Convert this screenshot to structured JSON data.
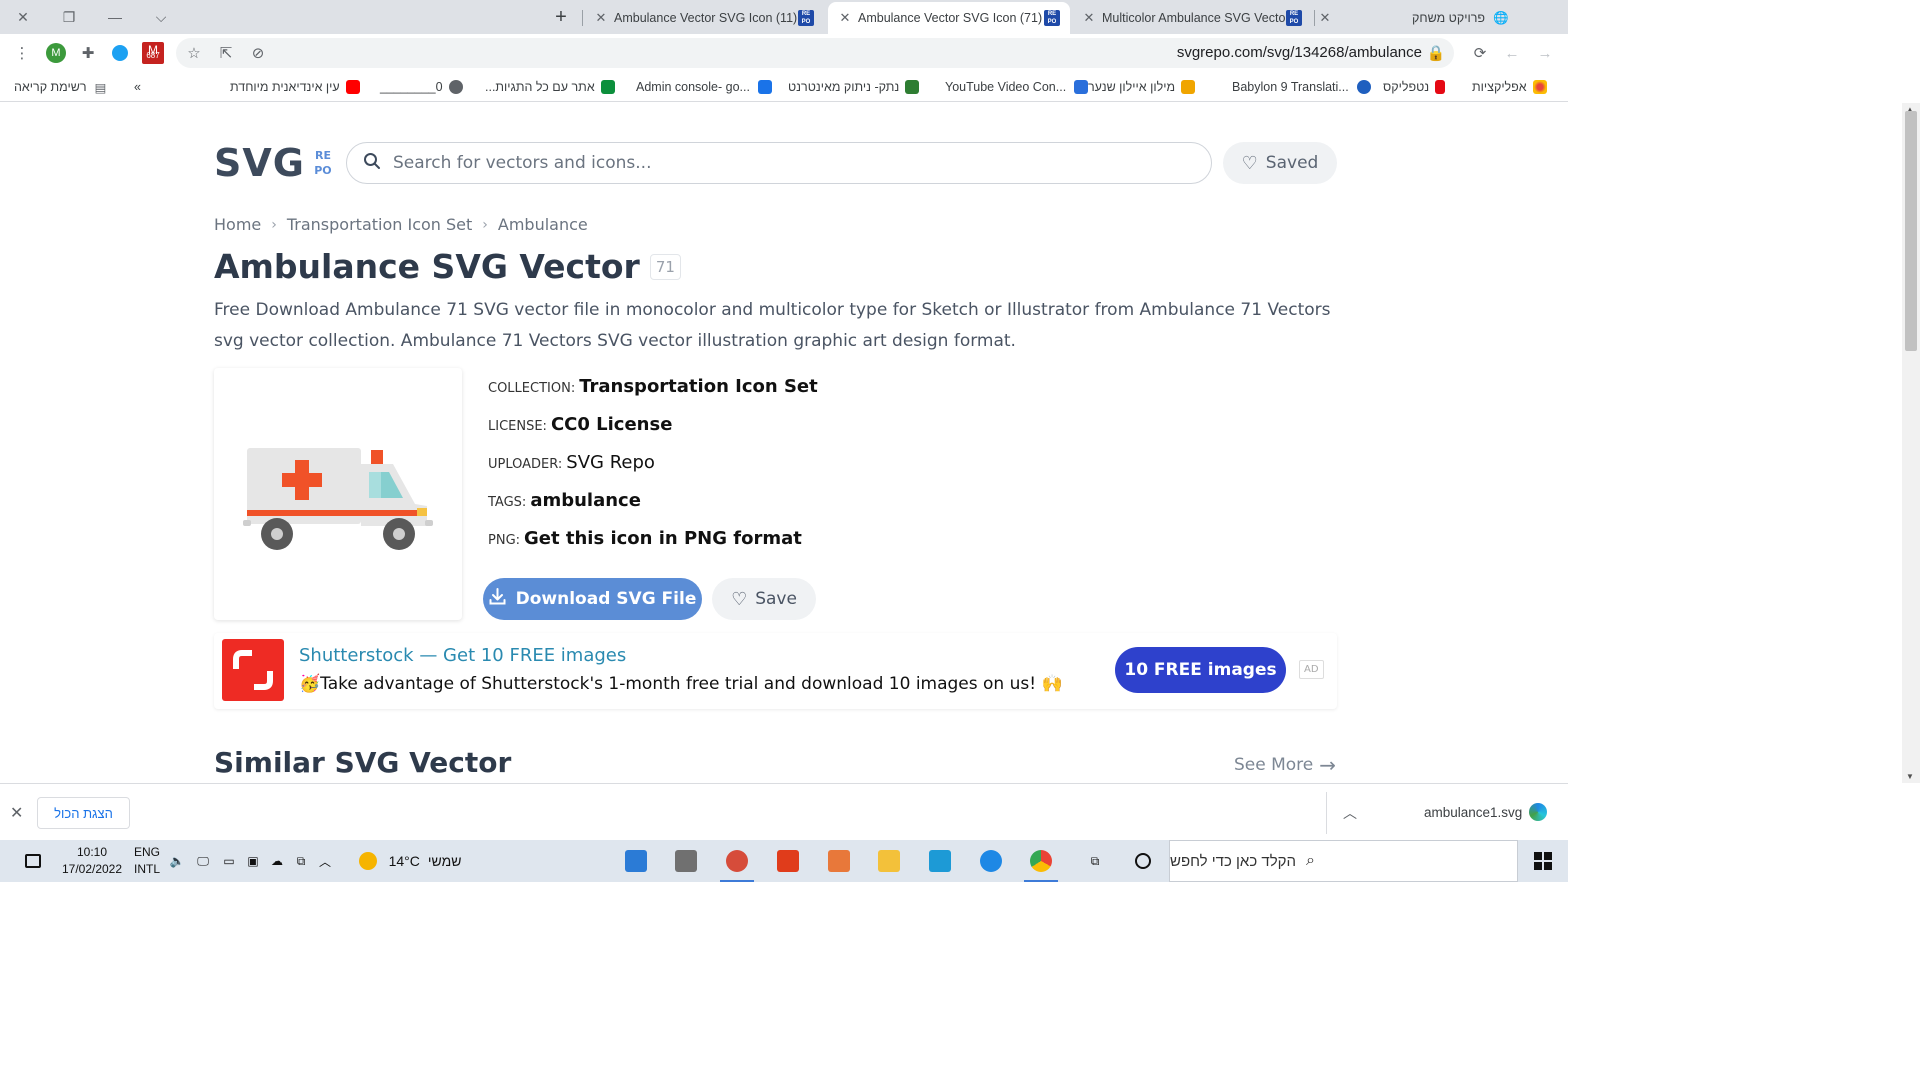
{
  "browser": {
    "tabs": [
      {
        "title": "Ambulance Vector SVG Icon (11)",
        "active": false
      },
      {
        "title": "Ambulance Vector SVG Icon (71)",
        "active": true
      },
      {
        "title": "Multicolor Ambulance SVG Vecto",
        "active": false
      }
    ],
    "profile_tab": "פרויקט משחק",
    "url": "svgrepo.com/svg/134268/ambulance",
    "avatar_letter": "M",
    "gmail_badge": "687"
  },
  "bookmarks": {
    "reading_list": "רשימת קריאה",
    "more": "»",
    "items": [
      {
        "label": "אפליקציות",
        "color": "#e8453c"
      },
      {
        "label": "נטפליקס",
        "color": "#e50914"
      },
      {
        "label": "Babylon 9 Translati...",
        "color": "#1f5fbf"
      },
      {
        "label": "מילון איילון שנער",
        "color": "#f0a500"
      },
      {
        "label": "YouTube Video Con...",
        "color": "#2a6fdb"
      },
      {
        "label": "נתק- ניתוק מאינטרנט",
        "color": "#2e7d32"
      },
      {
        "label": "Admin console- go...",
        "color": "#1a73e8"
      },
      {
        "label": "אתר עם כל התגיות...",
        "color": "#0c8f3c"
      },
      {
        "label": "0________",
        "color": "#5f6368"
      },
      {
        "label": "עין אינדיאנית מיוחדת",
        "color": "#ff0000"
      }
    ]
  },
  "site": {
    "logo_main": "SVG",
    "logo_sub": [
      "RE",
      "PO"
    ],
    "search_placeholder": "Search for vectors and icons...",
    "saved_label": "Saved"
  },
  "breadcrumb": [
    "Home",
    "Transportation Icon Set",
    "Ambulance"
  ],
  "heading": "Ambulance SVG Vector",
  "heading_count": "71",
  "description": "Free Download Ambulance 71 SVG vector file in monocolor and multicolor type for Sketch or Illustrator from Ambulance 71 Vectors svg vector collection. Ambulance 71 Vectors SVG vector illustration graphic art design format.",
  "meta": {
    "collection_label": "COLLECTION:",
    "collection_value": "Transportation Icon Set",
    "license_label": "LICENSE:",
    "license_value": "CC0 License",
    "uploader_label": "UPLOADER:",
    "uploader_value": "SVG Repo",
    "tags_label": "TAGS:",
    "tags_value": "ambulance",
    "png_label": "PNG:",
    "png_value": "Get this icon in PNG format"
  },
  "actions": {
    "download_label": "Download SVG File",
    "save_label": "Save"
  },
  "ad": {
    "title": "Shutterstock — Get 10 FREE images",
    "text": "🥳Take advantage of Shutterstock's 1-month free trial and download 10 images on us! 🙌",
    "cta": "10 FREE images",
    "badge": "AD"
  },
  "similar": {
    "heading": "Similar SVG Vector",
    "see_more": "See More"
  },
  "download_shelf": {
    "show_all": "הצגת הכול",
    "filename": "ambulance1.svg"
  },
  "taskbar": {
    "search_placeholder": "הקלד כאן כדי לחפש",
    "weather_temp": "14°C",
    "weather_desc": "שמשי",
    "lang_line1": "ENG",
    "lang_line2": "INTL",
    "time": "10:10",
    "date": "17/02/2022"
  },
  "colors": {
    "accent_blue": "#5b8dd6",
    "ad_cta": "#2e41cc",
    "ambulance_red": "#f05228",
    "ambulance_body": "#e6e6e6",
    "window_teal": "#86cfcf"
  }
}
